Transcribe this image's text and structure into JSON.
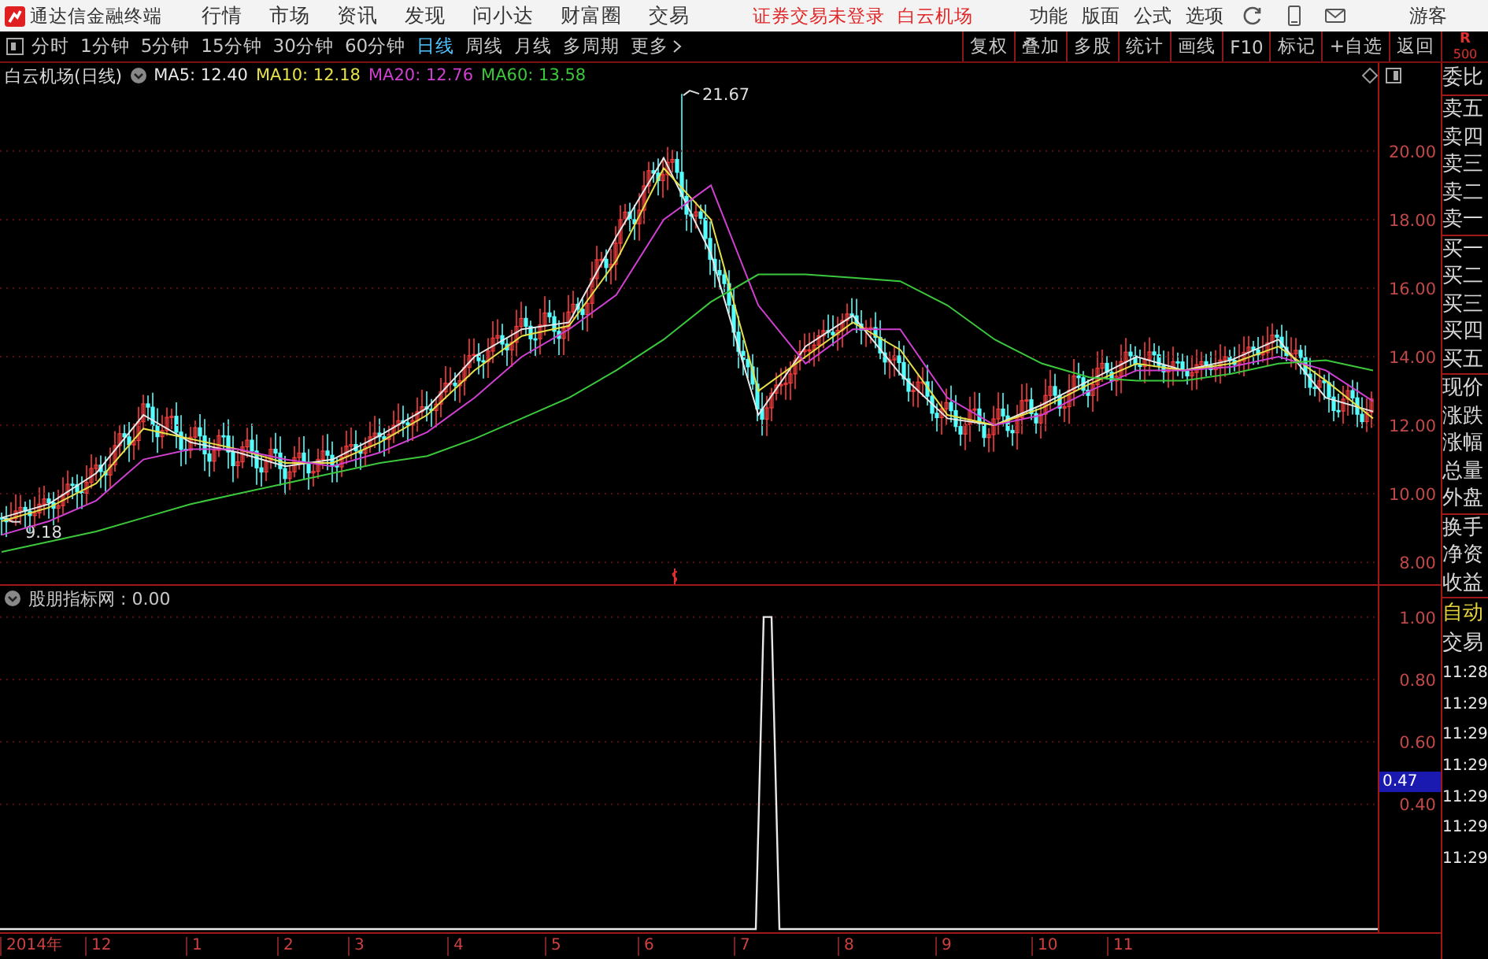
{
  "app": {
    "title": "通达信金融终端"
  },
  "menu": [
    "行情",
    "市场",
    "资讯",
    "发现",
    "问小达",
    "财富圈",
    "交易"
  ],
  "login_status": "证券交易未登录",
  "stock_link": "白云机场",
  "tools": [
    "功能",
    "版面",
    "公式",
    "选项"
  ],
  "user": "游客",
  "periods": [
    {
      "label": "分时",
      "selected": false
    },
    {
      "label": "1分钟",
      "selected": false
    },
    {
      "label": "5分钟",
      "selected": false
    },
    {
      "label": "15分钟",
      "selected": false
    },
    {
      "label": "30分钟",
      "selected": false
    },
    {
      "label": "60分钟",
      "selected": false
    },
    {
      "label": "日线",
      "selected": true
    },
    {
      "label": "周线",
      "selected": false
    },
    {
      "label": "月线",
      "selected": false
    },
    {
      "label": "多周期",
      "selected": false
    },
    {
      "label": "更多",
      "selected": false
    }
  ],
  "actions": [
    "复权",
    "叠加",
    "多股",
    "统计",
    "画线",
    "F10",
    "标记",
    "+自选",
    "返回"
  ],
  "level_badge": {
    "label": "R",
    "sub": "500"
  },
  "price_chart": {
    "title": "白云机场(日线)",
    "ma_readings": [
      ": 12.40",
      ": 12.18",
      ": 12.76",
      ": 13.58"
    ],
    "high_label": "21.67",
    "low_label": "9.18",
    "chart_data": {
      "type": "line",
      "ylim": [
        7.36,
        22.57
      ],
      "grid": true,
      "yticks": [
        {
          "value": 20,
          "label": "20.00"
        },
        {
          "value": 18,
          "label": "18.00"
        },
        {
          "value": 16,
          "label": "16.00"
        },
        {
          "value": 14,
          "label": "14.00"
        },
        {
          "value": 12,
          "label": "12.00"
        },
        {
          "value": 10,
          "label": "10.00"
        },
        {
          "value": 8,
          "label": "8.00"
        }
      ],
      "series": [
        {
          "name": "MA5",
          "color": "#e8e8e8",
          "values": [
            9.3,
            9.7,
            10.6,
            12.3,
            11.5,
            11.2,
            10.8,
            11.0,
            11.7,
            12.5,
            14.0,
            14.8,
            15.0,
            17.5,
            19.8,
            17.0,
            12.3,
            14.3,
            15.2,
            13.5,
            12.2,
            12.0,
            12.6,
            13.3,
            14.0,
            13.6,
            13.9,
            14.5,
            12.8,
            12.4
          ]
        },
        {
          "name": "MA10",
          "color": "#e6e04a",
          "values": [
            9.2,
            9.6,
            10.3,
            11.9,
            11.6,
            11.3,
            10.9,
            10.9,
            11.5,
            12.3,
            13.6,
            14.6,
            14.9,
            16.8,
            19.5,
            18.0,
            13.0,
            14.0,
            15.0,
            14.2,
            12.3,
            12.0,
            12.5,
            13.2,
            13.8,
            13.6,
            13.8,
            14.3,
            13.3,
            12.2
          ]
        },
        {
          "name": "MA20",
          "color": "#d040d0",
          "values": [
            8.8,
            9.2,
            9.8,
            11.0,
            11.3,
            11.3,
            11.0,
            10.8,
            11.2,
            11.8,
            12.8,
            14.0,
            14.8,
            15.8,
            18.0,
            19.0,
            15.5,
            13.8,
            14.8,
            14.8,
            12.8,
            12.0,
            12.3,
            13.0,
            13.6,
            13.6,
            13.7,
            14.0,
            13.6,
            12.7
          ]
        },
        {
          "name": "MA60",
          "color": "#3cc83c",
          "values": [
            8.3,
            8.6,
            8.9,
            9.3,
            9.7,
            10.0,
            10.3,
            10.6,
            10.9,
            11.1,
            11.6,
            12.2,
            12.8,
            13.6,
            14.5,
            15.6,
            16.4,
            16.4,
            16.3,
            16.2,
            15.5,
            14.5,
            13.8,
            13.4,
            13.3,
            13.3,
            13.5,
            13.8,
            13.9,
            13.6
          ]
        }
      ]
    }
  },
  "indicator": {
    "reading": " : 0.00",
    "cursor_value": "0.47",
    "chart_data": {
      "type": "line",
      "ylim": [
        -0.01,
        1.1
      ],
      "grid": true,
      "yticks": [
        {
          "value": 1,
          "label": "1.00"
        },
        {
          "value": 0.8,
          "label": "0.80"
        },
        {
          "value": 0.6,
          "label": "0.60"
        },
        {
          "value": 0.4,
          "label": "0.40"
        }
      ],
      "series": [
        {
          "name": "股朋指标网",
          "color": "#e8e8e8",
          "values": [
            0,
            0,
            0,
            0,
            0,
            0,
            0,
            0,
            0,
            0,
            0,
            0,
            0,
            0,
            0,
            0,
            0,
            0,
            0,
            0,
            0,
            0,
            0,
            0,
            0,
            0,
            0,
            0,
            0,
            0,
            0,
            0,
            0,
            0,
            0,
            0,
            0,
            0,
            0,
            0,
            0,
            0,
            0,
            0,
            0,
            0,
            0,
            0,
            0,
            0,
            0,
            0,
            0,
            0,
            0,
            0,
            0,
            0,
            0,
            0,
            0,
            0,
            0,
            0,
            0,
            0,
            0,
            0,
            0,
            0,
            0,
            0,
            0,
            0,
            0,
            0,
            0,
            0,
            0,
            0,
            0,
            0,
            0,
            0,
            0,
            0,
            0,
            0,
            0,
            0,
            0,
            0,
            0,
            0,
            0,
            0,
            0,
            1,
            1,
            0,
            0,
            0,
            0,
            0,
            0,
            0,
            0,
            0,
            0,
            0,
            0,
            0,
            0,
            0,
            0,
            0,
            0,
            0,
            0,
            0,
            0,
            0,
            0,
            0,
            0,
            0,
            0,
            0,
            0,
            0,
            0,
            0,
            0,
            0,
            0,
            0,
            0,
            0,
            0,
            0,
            0,
            0,
            0,
            0,
            0,
            0,
            0,
            0,
            0,
            0,
            0,
            0,
            0,
            0,
            0,
            0,
            0,
            0,
            0,
            0,
            0,
            0,
            0,
            0,
            0,
            0,
            0,
            0,
            0,
            0,
            0,
            0,
            0,
            0,
            0,
            0
          ]
        }
      ]
    }
  },
  "x_axis": [
    "2014年",
    "12",
    "1",
    "2",
    "3",
    "4",
    "5",
    "6",
    "7",
    "8",
    "9",
    "10",
    "11"
  ],
  "quote_panel": {
    "groups": [
      [
        "委比"
      ],
      [
        "卖五",
        "卖四",
        "卖三",
        "卖二",
        "卖一"
      ],
      [
        "买一",
        "买二",
        "买三",
        "买四",
        "买五"
      ],
      [
        "现价",
        "涨跌",
        "涨幅",
        "总量",
        "外盘"
      ],
      [
        "换手",
        "净资",
        "收益"
      ]
    ],
    "mode": "自动",
    "trade_label": "交易",
    "times": [
      "11:28",
      "11:29",
      "11:29",
      "11:29",
      "11:29",
      "11:29",
      "11:29"
    ]
  }
}
